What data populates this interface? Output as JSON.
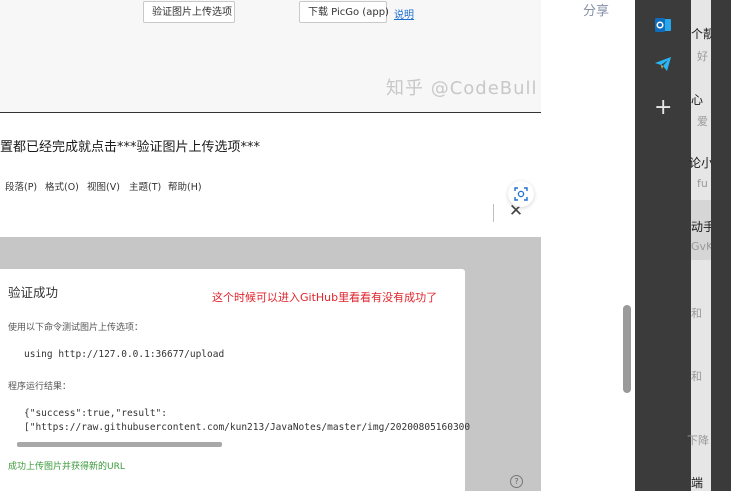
{
  "top_screenshot": {
    "verify_button": "验证图片上传选项",
    "download_button": "下载 PicGo (app)",
    "help_link": "说明",
    "watermark": "知乎 @CodeBull"
  },
  "article": {
    "step_text": "置都已经完成就点击***验证图片上传选项***",
    "share_label": "分享"
  },
  "editor_menu": {
    "items": [
      "段落(P)",
      "格式(O)",
      "视图(V)",
      "主题(T)",
      "帮助(H)"
    ]
  },
  "dialog": {
    "title": "验证成功",
    "annotation": "这个时候可以进入GitHub里看看有没有成功了",
    "command_label": "使用以下命令测试图片上传选项：",
    "command": "using http://127.0.0.1:36677/upload",
    "result_label": "程序运行结果：",
    "result_line_1": "{\"success\":true,\"result\":",
    "result_line_2": "[\"https://raw.githubusercontent.com/kun213/JavaNotes/master/img/20200805160300",
    "success_message": "成功上传图片并获得新的URL",
    "help_glyph": "?"
  },
  "side_panel": {
    "apps": [
      {
        "icon": "outlook-icon"
      },
      {
        "icon": "telegram-icon"
      },
      {
        "icon": "plus-icon",
        "glyph": "+"
      }
    ],
    "list_texts": [
      {
        "text": "个靓",
        "style": "main"
      },
      {
        "text": "好",
        "style": "sub"
      },
      {
        "text": "心",
        "style": "main"
      },
      {
        "text": "爱",
        "style": "sub"
      },
      {
        "text": "论小",
        "style": "main"
      },
      {
        "text": "fu",
        "style": "sub"
      },
      {
        "text": "动手",
        "style": "main"
      },
      {
        "text": "GvK",
        "style": "sub"
      },
      {
        "text": "和",
        "style": "sub"
      },
      {
        "text": "和",
        "style": "sub"
      },
      {
        "text": "下降",
        "style": "sub"
      },
      {
        "text": "端",
        "style": "main"
      }
    ]
  },
  "colors": {
    "annotation_red": "#e0242b",
    "success_green": "#3a9a3a",
    "link_blue": "#1f6fd0",
    "side_dark": "#3b3b3b"
  }
}
